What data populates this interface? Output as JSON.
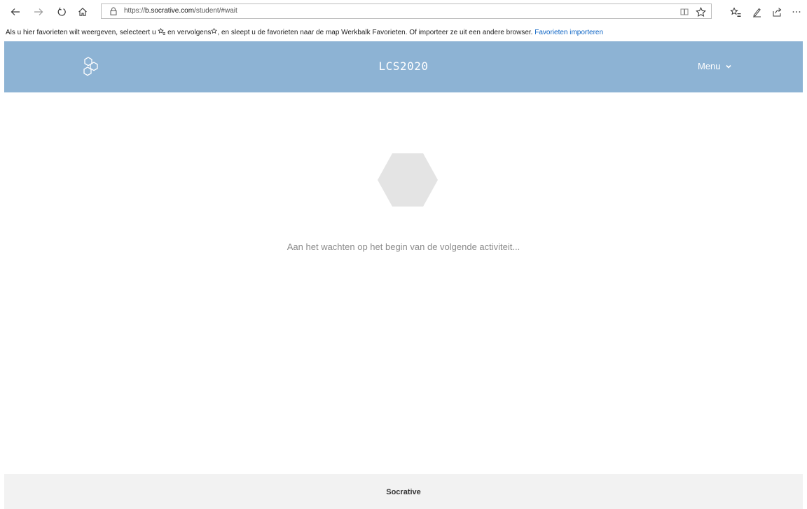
{
  "browser": {
    "url_prefix": "https://",
    "url_domain": "b.socrative.com",
    "url_path": "/student/#wait",
    "icons": [
      "back-arrow-icon",
      "forward-arrow-icon",
      "refresh-icon",
      "home-icon",
      "lock-icon",
      "reading-view-icon",
      "favorite-star-icon",
      "favorites-list-icon",
      "pen-icon",
      "share-icon",
      "more-icon"
    ]
  },
  "favbar": {
    "text_part1": "Als u hier favorieten wilt weergeven, selecteert u ",
    "text_part2": " en vervolgens",
    "text_part3": ", en sleept u de favorieten naar de map Werkbalk Favorieten. Of importeer ze uit een andere browser. ",
    "link": "Favorieten importeren"
  },
  "header": {
    "title": "LCS2020",
    "menu_label": "Menu",
    "background": "#8db3d4"
  },
  "main": {
    "wait_message": "Aan het wachten op het begin van de volgende activiteit..."
  },
  "footer": {
    "label": "Socrative"
  }
}
